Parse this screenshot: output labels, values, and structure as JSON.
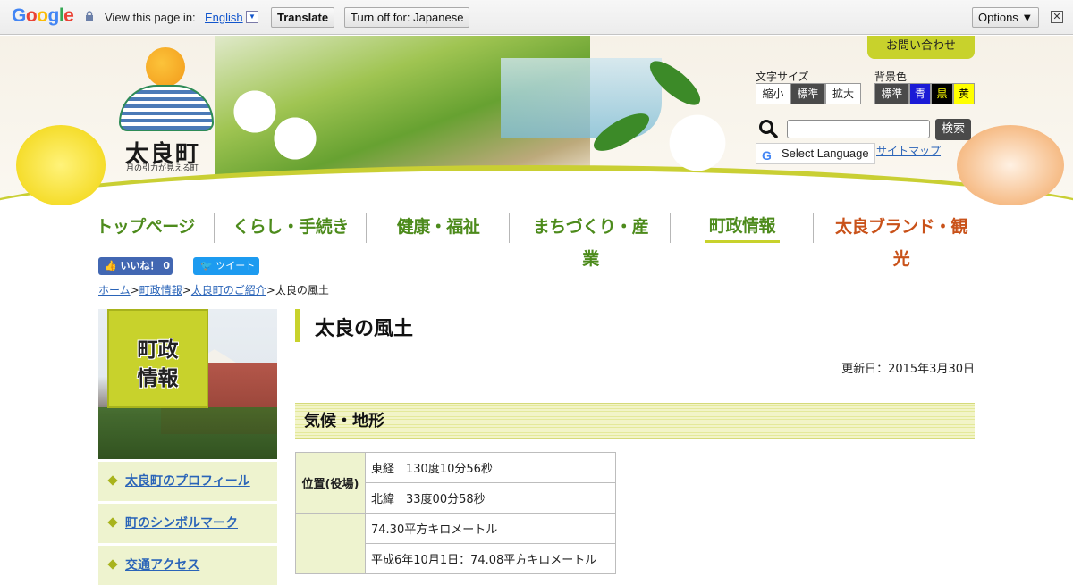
{
  "gtranslate": {
    "logo": "Google",
    "view_text": "View this page in:",
    "language": "English",
    "translate_label": "Translate",
    "turn_off_label": "Turn off for: Japanese",
    "options_label": "Options ▼",
    "close_glyph": "✕"
  },
  "header": {
    "town_name": "太良町",
    "tagline": "月の引力が見える町",
    "contact_label": "お問い合わせ",
    "font_size_label": "文字サイズ",
    "font_sizes": [
      "縮小",
      "標準",
      "拡大"
    ],
    "bg_color_label": "背景色",
    "bg_colors": [
      "標準",
      "青",
      "黒",
      "黄"
    ],
    "search_button": "検索",
    "select_language": "Select Language",
    "sitemap": "サイトマップ"
  },
  "nav": {
    "items": [
      "トップページ",
      "くらし・手続き",
      "健康・福祉",
      "まちづくり・産業",
      "町政情報",
      "太良ブランド・観光"
    ],
    "active_index": 4
  },
  "social": {
    "like_label": "いいね！ 0",
    "tweet_label": "ツイート"
  },
  "breadcrumb": {
    "links": [
      "ホーム",
      "町政情報",
      "太良町のご紹介"
    ],
    "sep": ">",
    "current": "太良の風土"
  },
  "side": {
    "title_line1": "町政",
    "title_line2": "情報",
    "items": [
      "太良町のプロフィール",
      "町のシンボルマーク",
      "交通アクセス"
    ]
  },
  "main": {
    "title": "太良の風土",
    "updated": "更新日：2015年3月30日",
    "section_title": "気候・地形",
    "table": {
      "row_header_1": "位置(役場)",
      "rows": [
        "東経　130度10分56秒",
        "北緯　33度00分58秒",
        "74.30平方キロメートル",
        "平成6年10月1日：74.08平方キロメートル"
      ]
    }
  },
  "colors": {
    "accent": "#c8d22c",
    "nav_text": "#4d8b1c",
    "nav_brand": "#c9521a",
    "link": "#2a64b8"
  }
}
